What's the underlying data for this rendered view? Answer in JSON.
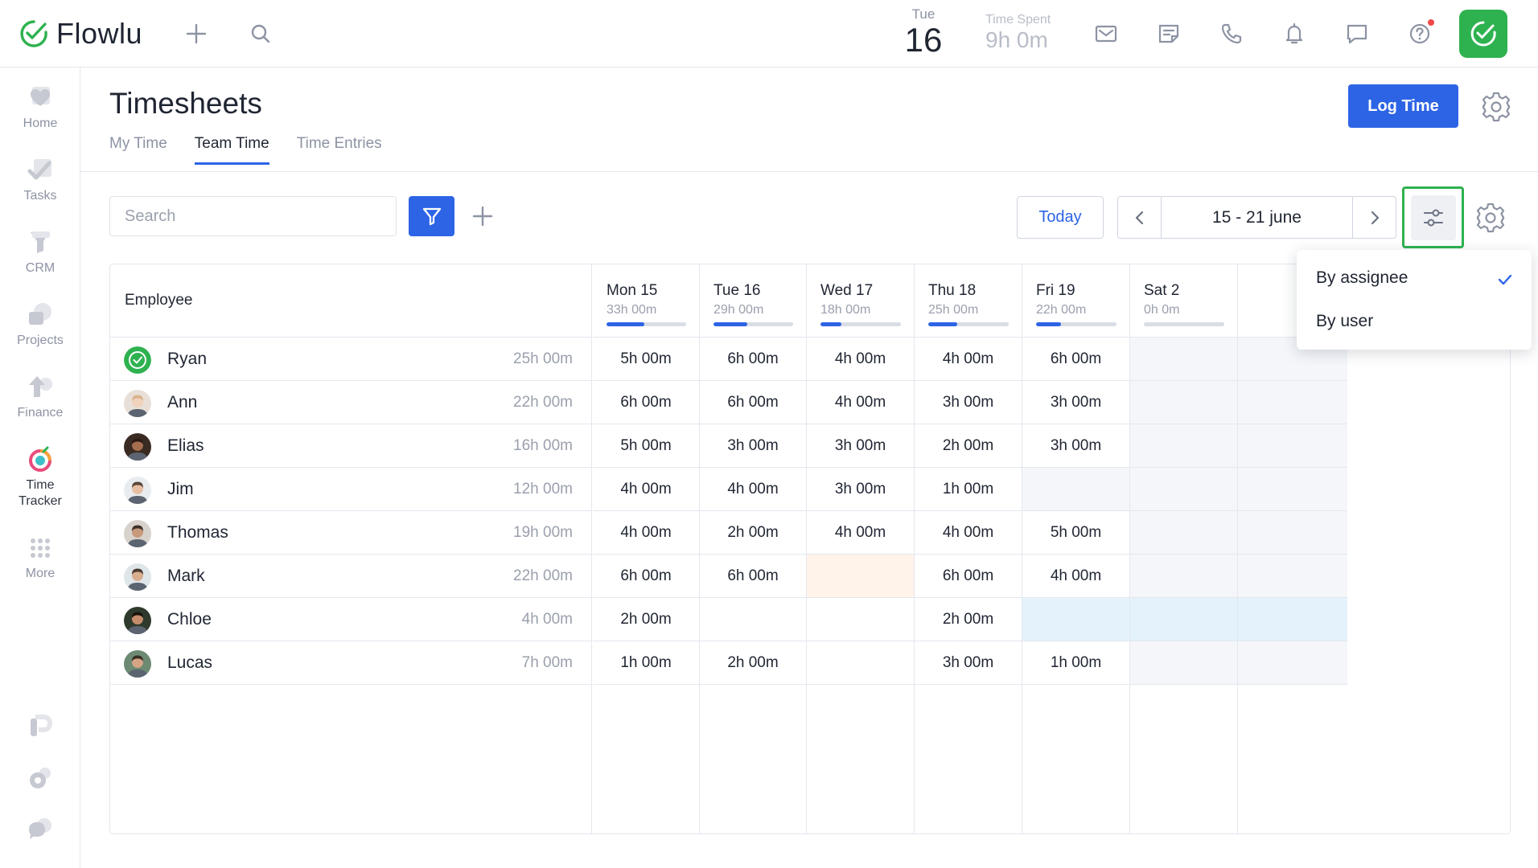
{
  "app": {
    "name": "Flowlu",
    "accent": "#2d64e6",
    "brand_green": "#2eb24f"
  },
  "topbar": {
    "date_dow": "Tue",
    "date_day": "16",
    "time_spent_label": "Time Spent",
    "time_spent_value": "9h 0m",
    "icons": [
      "plus-icon",
      "search-icon",
      "mail-icon",
      "notes-icon",
      "phone-icon",
      "bell-icon",
      "chat-icon",
      "help-icon",
      "timer-check-icon"
    ]
  },
  "sidebar": {
    "items": [
      {
        "label": "Home",
        "icon": "home-icon"
      },
      {
        "label": "Tasks",
        "icon": "tasks-icon"
      },
      {
        "label": "CRM",
        "icon": "crm-icon"
      },
      {
        "label": "Projects",
        "icon": "projects-icon"
      },
      {
        "label": "Finance",
        "icon": "finance-icon"
      },
      {
        "label": "Time Tracker",
        "icon": "time-tracker-icon",
        "active": true
      },
      {
        "label": "More",
        "icon": "more-icon"
      }
    ],
    "bottom_icons": [
      "app-p-icon",
      "settings-icon",
      "support-chat-icon"
    ]
  },
  "header": {
    "title": "Timesheets",
    "tabs": [
      "My Time",
      "Team Time",
      "Time Entries"
    ],
    "active_tab": "Team Time",
    "log_time_label": "Log Time"
  },
  "toolbar": {
    "search_placeholder": "Search",
    "today_label": "Today",
    "date_range": "15 - 21 june"
  },
  "table": {
    "employee_header": "Employee",
    "days": [
      {
        "name": "Mon 15",
        "total": "33h 00m",
        "progress": 0.47
      },
      {
        "name": "Tue 16",
        "total": "29h 00m",
        "progress": 0.42
      },
      {
        "name": "Wed 17",
        "total": "18h 00m",
        "progress": 0.26
      },
      {
        "name": "Thu 18",
        "total": "25h 00m",
        "progress": 0.36
      },
      {
        "name": "Fri 19",
        "total": "22h 00m",
        "progress": 0.31
      },
      {
        "name": "Sat 2",
        "total": "0h 0m",
        "progress": 0
      },
      {
        "name": "",
        "total": "",
        "progress": 0
      }
    ],
    "rows": [
      {
        "name": "Ryan",
        "total": "25h 00m",
        "cells": [
          "5h 00m",
          "6h 00m",
          "4h 00m",
          "4h 00m",
          "6h 00m",
          "",
          ""
        ]
      },
      {
        "name": "Ann",
        "total": "22h 00m",
        "cells": [
          "6h 00m",
          "6h 00m",
          "4h 00m",
          "3h 00m",
          "3h 00m",
          "",
          ""
        ]
      },
      {
        "name": "Elias",
        "total": "16h 00m",
        "cells": [
          "5h 00m",
          "3h 00m",
          "3h 00m",
          "2h 00m",
          "3h 00m",
          "",
          ""
        ]
      },
      {
        "name": "Jim",
        "total": "12h 00m",
        "cells": [
          "4h 00m",
          "4h 00m",
          "3h 00m",
          "1h 00m",
          "",
          "",
          ""
        ]
      },
      {
        "name": "Thomas",
        "total": "19h 00m",
        "cells": [
          "4h 00m",
          "2h 00m",
          "4h 00m",
          "4h 00m",
          "5h 00m",
          "",
          ""
        ]
      },
      {
        "name": "Mark",
        "total": "22h 00m",
        "cells": [
          "6h 00m",
          "6h 00m",
          "",
          "6h 00m",
          "4h 00m",
          "",
          ""
        ]
      },
      {
        "name": "Chloe",
        "total": "4h 00m",
        "cells": [
          "2h 00m",
          "",
          "",
          "2h 00m",
          "",
          "",
          ""
        ]
      },
      {
        "name": "Lucas",
        "total": "7h 00m",
        "cells": [
          "1h 00m",
          "2h 00m",
          "",
          "3h 00m",
          "1h 00m",
          "",
          ""
        ]
      }
    ]
  },
  "dropdown": {
    "items": [
      {
        "label": "By assignee",
        "checked": true
      },
      {
        "label": "By user",
        "checked": false
      }
    ]
  }
}
